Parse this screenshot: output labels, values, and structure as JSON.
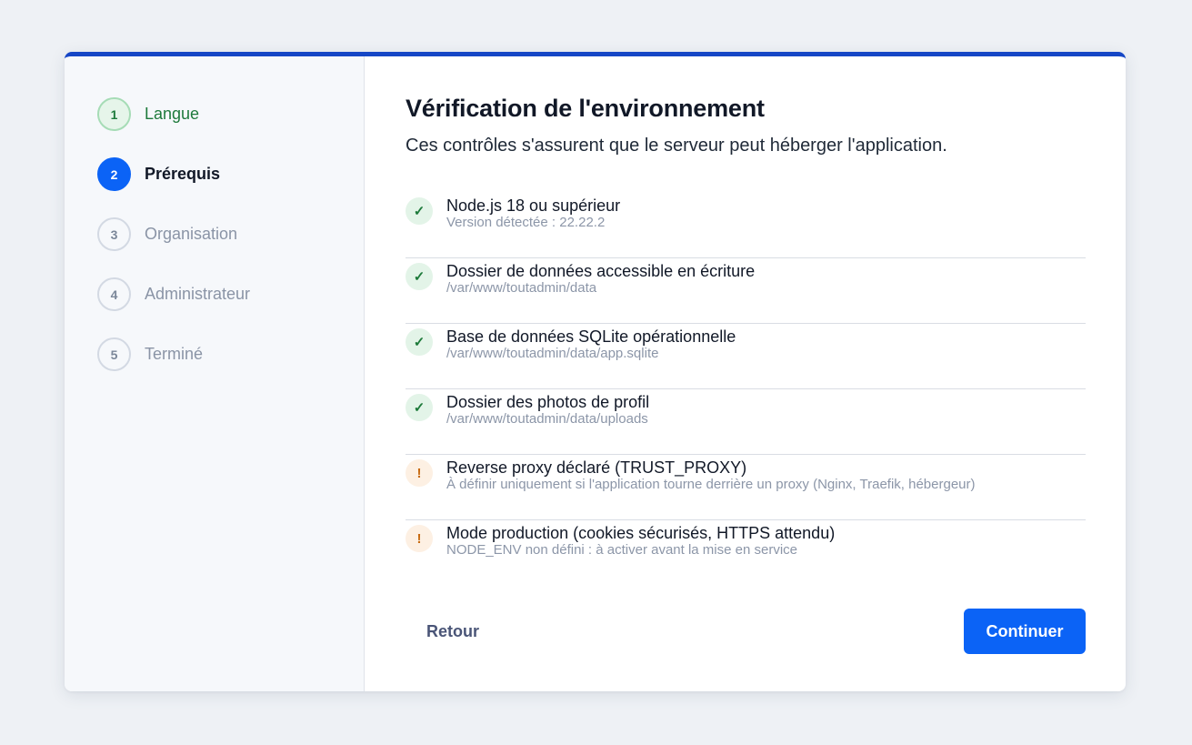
{
  "steps": [
    {
      "num": "1",
      "label": "Langue",
      "state": "done"
    },
    {
      "num": "2",
      "label": "Prérequis",
      "state": "active"
    },
    {
      "num": "3",
      "label": "Organisation",
      "state": "pending"
    },
    {
      "num": "4",
      "label": "Administrateur",
      "state": "pending"
    },
    {
      "num": "5",
      "label": "Terminé",
      "state": "pending"
    }
  ],
  "main": {
    "title": "Vérification de l'environnement",
    "subtitle": "Ces contrôles s'assurent que le serveur peut héberger l'application."
  },
  "checks": [
    {
      "status": "ok",
      "icon": "check-icon",
      "symbol": "✓",
      "title": "Node.js 18 ou supérieur",
      "detail": "Version détectée : 22.22.2"
    },
    {
      "status": "ok",
      "icon": "check-icon",
      "symbol": "✓",
      "title": "Dossier de données accessible en écriture",
      "detail": "/var/www/toutadmin/data"
    },
    {
      "status": "ok",
      "icon": "check-icon",
      "symbol": "✓",
      "title": "Base de données SQLite opérationnelle",
      "detail": "/var/www/toutadmin/data/app.sqlite"
    },
    {
      "status": "ok",
      "icon": "check-icon",
      "symbol": "✓",
      "title": "Dossier des photos de profil",
      "detail": "/var/www/toutadmin/data/uploads"
    },
    {
      "status": "warn",
      "icon": "warning-icon",
      "symbol": "!",
      "title": "Reverse proxy déclaré (TRUST_PROXY)",
      "detail": "À définir uniquement si l'application tourne derrière un proxy (Nginx, Traefik, hébergeur)"
    },
    {
      "status": "warn",
      "icon": "warning-icon",
      "symbol": "!",
      "title": "Mode production (cookies sécurisés, HTTPS attendu)",
      "detail": "NODE_ENV non défini : à activer avant la mise en service"
    }
  ],
  "footer": {
    "back_label": "Retour",
    "next_label": "Continuer"
  },
  "colors": {
    "accent": "#0b63f6",
    "top_border": "#1546c6",
    "ok": "#1d7a3a",
    "warn": "#c86a10"
  }
}
